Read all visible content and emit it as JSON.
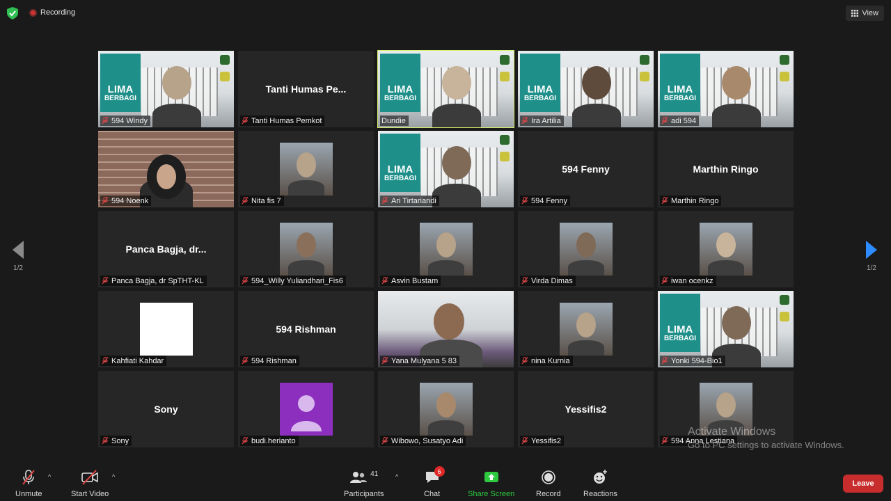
{
  "topbar": {
    "recording_label": "Recording",
    "view_label": "View"
  },
  "pager": {
    "left_label": "1/2",
    "right_label": "1/2"
  },
  "participants": [
    {
      "name": "594 Windy",
      "display": "",
      "video": "lima"
    },
    {
      "name": "Tanti Humas Pemkot",
      "display": "Tanti Humas Pe...",
      "video": "none"
    },
    {
      "name": "Dundie",
      "display": "",
      "video": "lima",
      "active": true
    },
    {
      "name": "Ira Artilia",
      "display": "",
      "video": "lima"
    },
    {
      "name": "adi 594",
      "display": "",
      "video": "lima"
    },
    {
      "name": "594 Noenk",
      "display": "",
      "video": "brick"
    },
    {
      "name": "Nita fis 7",
      "display": "",
      "video": "photo"
    },
    {
      "name": "Ari Tirtariandi",
      "display": "",
      "video": "lima"
    },
    {
      "name": "594 Fenny",
      "display": "594 Fenny",
      "video": "none"
    },
    {
      "name": "Marthin Ringo",
      "display": "Marthin Ringo",
      "video": "none"
    },
    {
      "name": "Panca Bagja, dr SpTHT-KL",
      "display": "Panca Bagja, dr...",
      "video": "none"
    },
    {
      "name": "594_Willy Yuliandhari_Fis6",
      "display": "",
      "video": "photo"
    },
    {
      "name": "Asvin Bustam",
      "display": "",
      "video": "photo"
    },
    {
      "name": "Virda Dimas",
      "display": "",
      "video": "photo"
    },
    {
      "name": "iwan ocenkz",
      "display": "",
      "video": "photo"
    },
    {
      "name": "Kahfiati Kahdar",
      "display": "",
      "video": "white"
    },
    {
      "name": "594 Rishman",
      "display": "594 Rishman",
      "video": "none"
    },
    {
      "name": "Yana Mulyana 5 83",
      "display": "",
      "video": "live"
    },
    {
      "name": "nina Kurnia",
      "display": "",
      "video": "photo"
    },
    {
      "name": "Yonki 594-Bio1",
      "display": "",
      "video": "lima"
    },
    {
      "name": "Sony",
      "display": "Sony",
      "video": "none"
    },
    {
      "name": "budi.herianto",
      "display": "",
      "video": "avatar"
    },
    {
      "name": "Wibowo, Susatyo Adi",
      "display": "",
      "video": "photo"
    },
    {
      "name": "Yessifis2",
      "display": "Yessifis2",
      "video": "none"
    },
    {
      "name": "594 Anna Lestiana",
      "display": "",
      "video": "photo"
    }
  ],
  "lima_logo": {
    "line1": "LIMA",
    "line2": "BERBAGI"
  },
  "toolbar": {
    "unmute_label": "Unmute",
    "start_video_label": "Start Video",
    "participants_label": "Participants",
    "participants_count": "41",
    "chat_label": "Chat",
    "chat_badge": "6",
    "share_label": "Share Screen",
    "record_label": "Record",
    "reactions_label": "Reactions",
    "leave_label": "Leave"
  },
  "watermark": {
    "line1": "Activate Windows",
    "line2": "Go to PC settings to activate Windows."
  },
  "colors": {
    "active_speaker": "#d7f26b",
    "share_green": "#2dc93f",
    "leave_red": "#c72d2d",
    "muted_red": "#e04646"
  }
}
